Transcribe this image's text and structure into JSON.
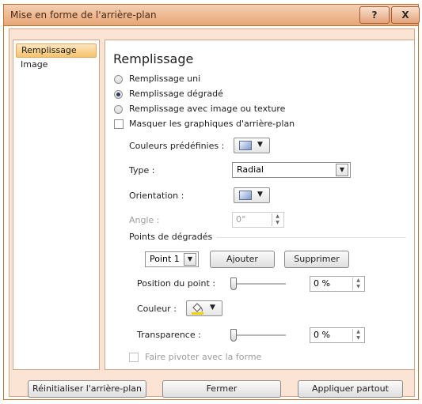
{
  "window": {
    "title": "Mise en forme de l'arrière-plan",
    "help_label": "?",
    "close_label": "X"
  },
  "sidebar": {
    "items": [
      {
        "label": "Remplissage",
        "selected": true
      },
      {
        "label": "Image",
        "selected": false
      }
    ]
  },
  "panel": {
    "heading": "Remplissage",
    "fill_options": [
      {
        "label": "Remplissage uni",
        "checked": false
      },
      {
        "label": "Remplissage dégradé",
        "checked": true
      },
      {
        "label": "Remplissage avec image ou texture",
        "checked": false
      }
    ],
    "hide_graphics_label": "Masquer les graphiques d'arrière-plan",
    "preset_colors_label": "Couleurs prédéfinies :",
    "type_label": "Type :",
    "type_value": "Radial",
    "orientation_label": "Orientation :",
    "angle_label": "Angle :",
    "angle_value": "0°",
    "gradient_stops_label": "Points de dégradés",
    "stop_value": "Point 1",
    "add_label": "Ajouter",
    "remove_label": "Supprimer",
    "position_label": "Position du point :",
    "position_value": "0 %",
    "position_fraction": 0,
    "color_label": "Couleur :",
    "transparency_label": "Transparence :",
    "transparency_value": "0 %",
    "transparency_fraction": 0,
    "rotate_label": "Faire pivoter avec la forme"
  },
  "footer": {
    "reset_label": "Réinitialiser l'arrière-plan",
    "close_label": "Fermer",
    "apply_all_label": "Appliquer partout"
  },
  "colors": {
    "title_gradient_top": "#f6cfb2",
    "title_gradient_bottom": "#e7a676",
    "frame_bg": "#fbe4d3",
    "selected_item_bg": "#f5c36c"
  }
}
